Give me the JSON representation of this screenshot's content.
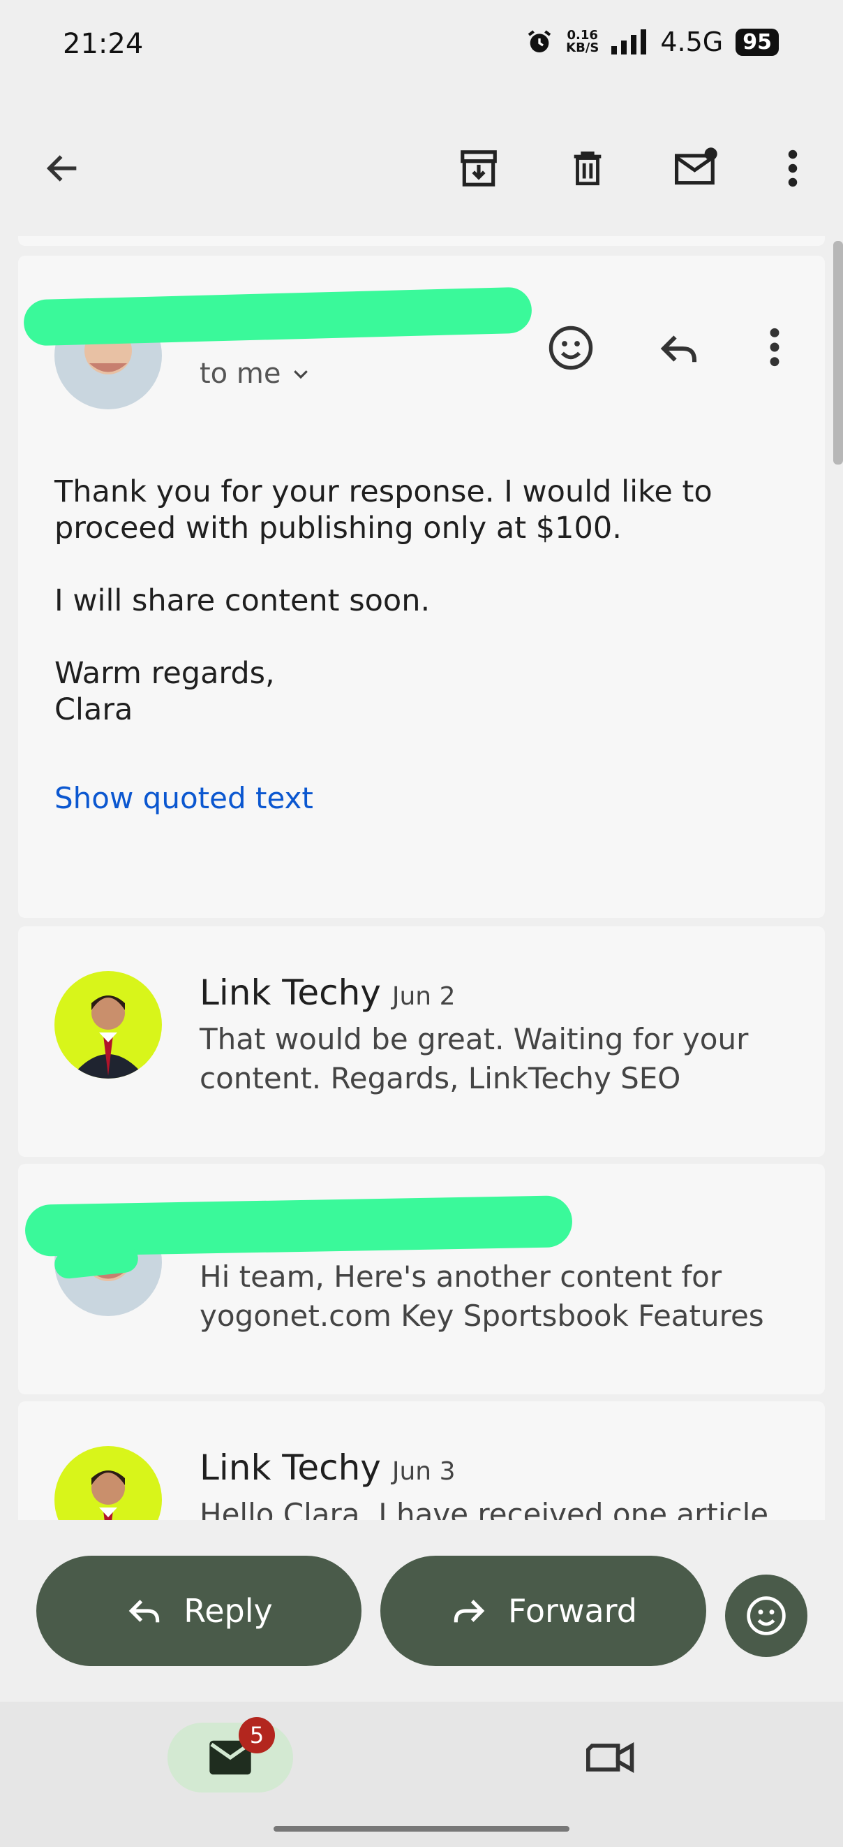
{
  "status_bar": {
    "time": "21:24",
    "net_speed_value": "0.16",
    "net_speed_unit": "KB/S",
    "network": "4.5G",
    "battery": "95"
  },
  "toolbar": {
    "back_icon": "arrow-left-icon",
    "archive_icon": "archive-icon",
    "delete_icon": "trash-icon",
    "mark_unread_icon": "mail-unread-icon",
    "more_icon": "more-vert-icon"
  },
  "open_message": {
    "recipient": "to me",
    "body_lines": [
      "Thank you for your response. I would like to",
      "proceed with publishing only at $100.",
      "",
      "I will share content soon.",
      "",
      "Warm regards,",
      "Clara"
    ],
    "show_quoted": "Show quoted text"
  },
  "thread": [
    {
      "sender": "Link Techy",
      "date": "Jun 2",
      "snippet": "That would be great. Waiting for your content. Regards, LinkTechy SEO"
    },
    {
      "sender": "",
      "date": "",
      "snippet": "Hi team, Here's another content for yogonet.com Key Sportsbook Features"
    },
    {
      "sender": "Link Techy",
      "date": "Jun 3",
      "snippet": "Hello Clara, I have received one article"
    }
  ],
  "actions": {
    "reply": "Reply",
    "forward": "Forward"
  },
  "bottom_nav": {
    "mail_badge": "5"
  },
  "colors": {
    "accent_button": "#4a5b4a",
    "link": "#0b57d0",
    "redaction": "#3af99a",
    "badge": "#b3261e",
    "techy_avatar_bg": "#d8f51a"
  }
}
